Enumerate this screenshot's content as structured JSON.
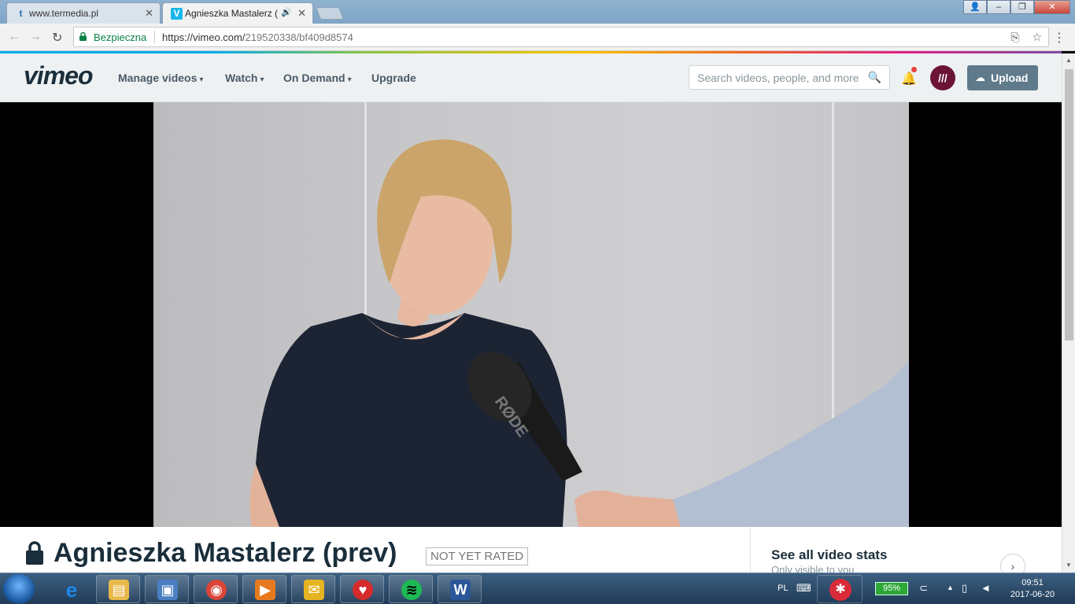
{
  "browser": {
    "tabs": [
      {
        "favicon": "t",
        "title": "www.termedia.pl",
        "close": "✕"
      },
      {
        "favicon": "V",
        "title": "Agnieszka Mastalerz (",
        "close": "✕",
        "audio": "🔊"
      }
    ],
    "window_buttons": {
      "profile": "👤",
      "minimize": "–",
      "restore": "❐",
      "close": "✕"
    },
    "nav": {
      "back": "←",
      "forward": "→",
      "reload": "↻"
    },
    "address": {
      "secure_label": "Bezpieczna",
      "url_host": "https://vimeo.com/",
      "url_path": "219520338/bf409d8574",
      "translate": "⎘",
      "star": "☆"
    },
    "menu": "⋮"
  },
  "vimeo": {
    "logo": "vimeo",
    "nav": [
      {
        "label": "Manage videos",
        "chevron": "▾"
      },
      {
        "label": "Watch",
        "chevron": "▾"
      },
      {
        "label": "On Demand",
        "chevron": "▾"
      },
      {
        "label": "Upgrade"
      }
    ],
    "search_placeholder": "Search videos, people, and more",
    "search_icon": "🔍",
    "bell_icon": "🔔",
    "avatar_text": "///",
    "upload_label": "Upload",
    "upload_icon": "☁"
  },
  "video": {
    "title": "Agnieszka Mastalerz (prev)",
    "rating": "NOT YET RATED",
    "stats_title": "See all video stats",
    "stats_sub": "Only visible to you",
    "stats_arrow": "›",
    "mic_brand": "RØDE"
  },
  "taskbar": {
    "language": "PL",
    "battery": "95%",
    "time": "09:51",
    "date": "2017-06-20",
    "apps": [
      {
        "name": "internet-explorer",
        "glyph": "e",
        "color": "#1e88e5"
      },
      {
        "name": "file-explorer",
        "glyph": "▤",
        "color": "#e8b84a"
      },
      {
        "name": "control-panel",
        "glyph": "▣",
        "color": "#4a7fc1"
      },
      {
        "name": "chrome",
        "glyph": "◉",
        "color": "#db4437"
      },
      {
        "name": "media-player",
        "glyph": "▶",
        "color": "#e77a1e"
      },
      {
        "name": "outlook",
        "glyph": "✉",
        "color": "#e6b422"
      },
      {
        "name": "health-app",
        "glyph": "♥",
        "color": "#d62b2b"
      },
      {
        "name": "spotify",
        "glyph": "≋",
        "color": "#1db954"
      },
      {
        "name": "word",
        "glyph": "W",
        "color": "#2b579a"
      }
    ]
  }
}
